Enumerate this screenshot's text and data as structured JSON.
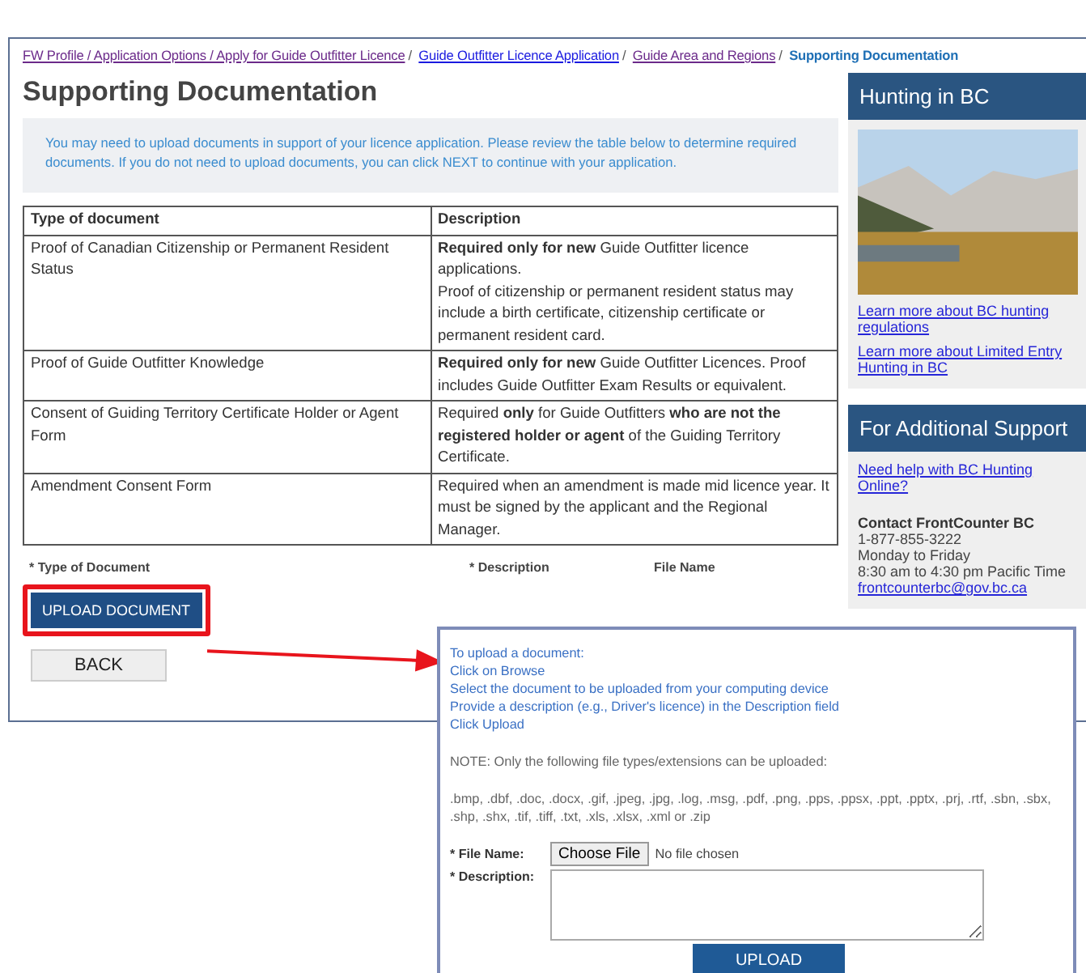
{
  "breadcrumbs": [
    {
      "label": "FW Profile / Application Options / Apply for Guide Outfitter Licence",
      "kind": "link",
      "visited": true
    },
    {
      "label": "Guide Outfitter Licence Application",
      "kind": "link",
      "visited": false
    },
    {
      "label": "Guide Area and Regions",
      "kind": "link",
      "visited": true
    },
    {
      "label": "Supporting Documentation",
      "kind": "current"
    }
  ],
  "breadcrumb_separator": "/",
  "page_title": "Supporting Documentation",
  "intro": "You may need to upload documents in support of your licence application. Please review the table below to determine required documents. If you do not need to upload documents, you can click NEXT to continue with your application.",
  "table": {
    "columns": [
      "Type of document",
      "Description"
    ],
    "rows": [
      {
        "type": "Proof of Canadian Citizenship or Permanent Resident Status",
        "description": [
          "**Required only for new** Guide Outfitter licence applications.",
          "Proof of citizenship or permanent resident status may include a birth certificate, citizenship certificate or permanent resident card."
        ]
      },
      {
        "type": "Proof of Guide Outfitter Knowledge",
        "description": [
          "**Required only for new** Guide Outfitter Licences. Proof includes Guide Outfitter Exam Results or equivalent."
        ]
      },
      {
        "type": "Consent of Guiding Territory Certificate Holder or Agent Form",
        "description": [
          "Required **only** for Guide Outfitters **who are not the registered holder or agent** of the Guiding Territory Certificate."
        ]
      },
      {
        "type": "Amendment Consent Form",
        "description": [
          "Required when an amendment is made mid licence year. It must be signed by the applicant and the Regional Manager."
        ]
      }
    ]
  },
  "upload_list_columns": [
    "* Type of Document",
    "* Description",
    "File Name"
  ],
  "upload_button": "UPLOAD DOCUMENT",
  "back_button": "BACK",
  "sidebar": {
    "hunting": {
      "title": "Hunting in BC",
      "links": [
        "Learn more about BC hunting regulations",
        "Learn more about Limited Entry Hunting in BC"
      ]
    },
    "support": {
      "title": "For Additional Support",
      "link": "Need help with BC Hunting Online?",
      "contact_title": "Contact FrontCounter BC",
      "contact_lines": [
        "1-877-855-3222",
        "Monday to Friday",
        "8:30 am to 4:30 pm Pacific Time"
      ],
      "email": "frontcounterbc@gov.bc.ca"
    }
  },
  "upload_dialog": {
    "instructions": [
      "To upload a document:",
      "Click on Browse",
      "Select the document to be uploaded from your computing device",
      "Provide a description (e.g., Driver's licence) in the Description field",
      "Click Upload"
    ],
    "note": "NOTE: Only the following file types/extensions can be uploaded:",
    "extensions": ".bmp, .dbf, .doc, .docx, .gif, .jpeg, .jpg, .log, .msg, .pdf, .png, .pps, .ppsx, .ppt, .pptx, .prj, .rtf, .sbn, .sbx, .shp, .shx, .tif, .tiff, .txt, .xls, .xlsx, .xml or .zip",
    "file_label": "* File Name:",
    "choose_file": "Choose File",
    "file_status": "No file chosen",
    "description_label": "* Description:",
    "upload": "UPLOAD"
  }
}
